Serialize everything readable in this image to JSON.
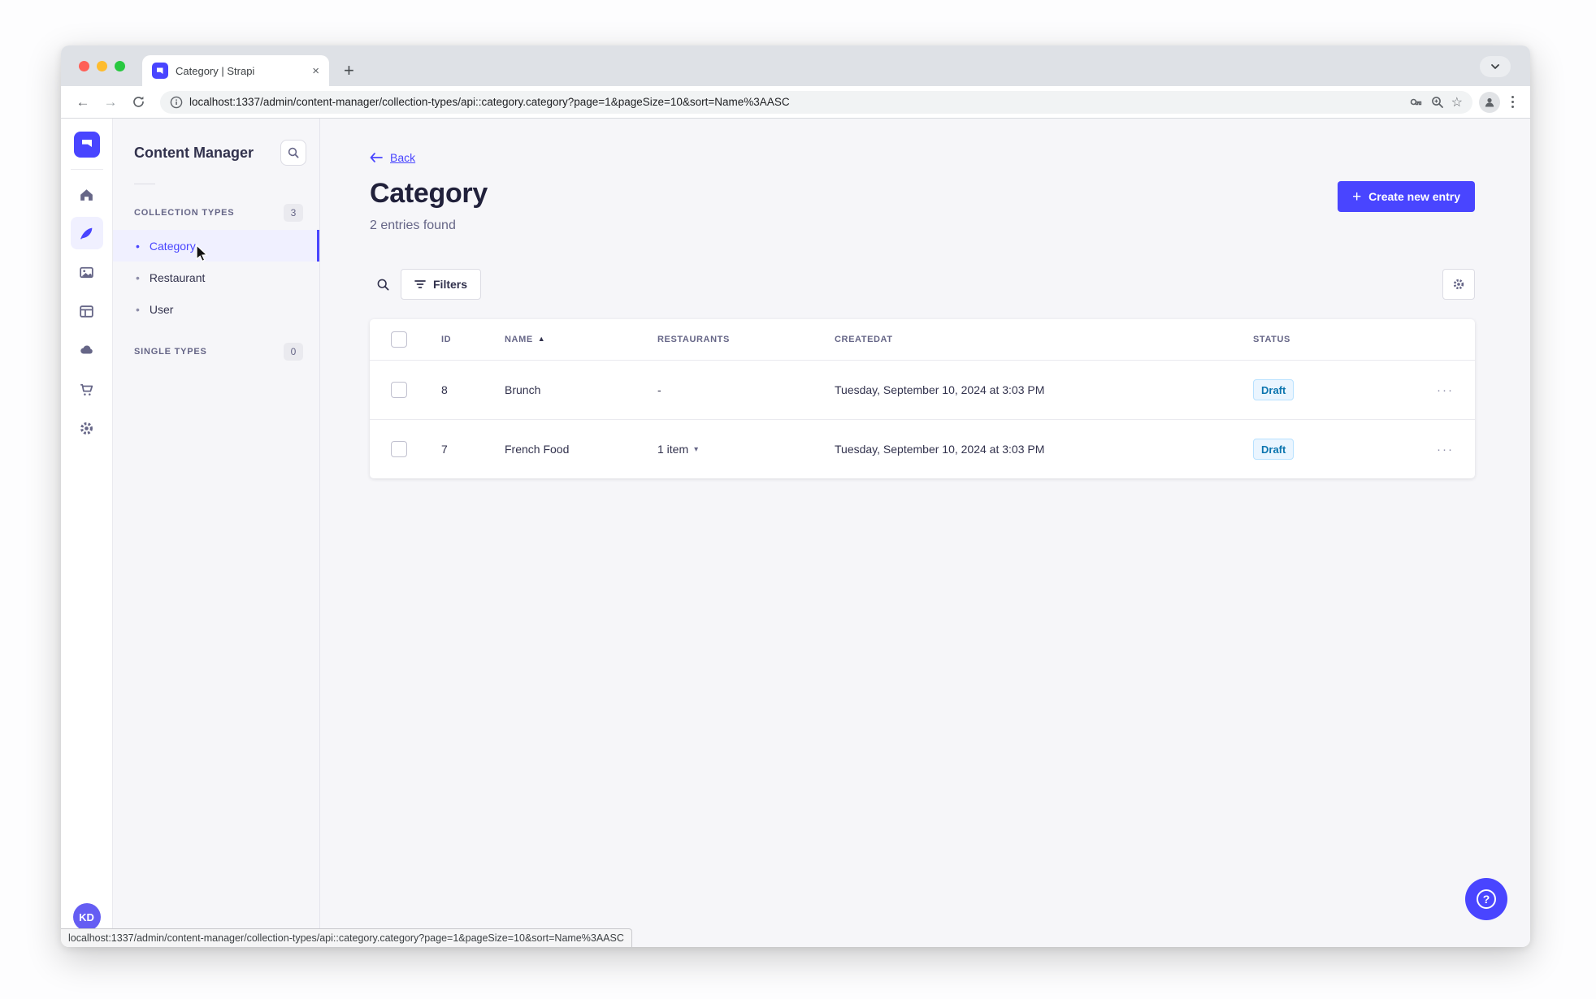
{
  "browser": {
    "tab_title": "Category | Strapi",
    "url": "localhost:1337/admin/content-manager/collection-types/api::category.category?page=1&pageSize=10&sort=Name%3AASC",
    "status_url": "localhost:1337/admin/content-manager/collection-types/api::category.category?page=1&pageSize=10&sort=Name%3AASC"
  },
  "glyphs": {
    "close": "×",
    "new_tab": "+",
    "back_arrow": "←",
    "forward_arrow": "→",
    "star": "☆",
    "bullet": "•",
    "sort_asc": "▲",
    "caret_down": "▾",
    "row_actions": "···",
    "plus": "+",
    "question": "?"
  },
  "sidebar": {
    "user_initials": "KD"
  },
  "subnav": {
    "title": "Content Manager",
    "collection_section": {
      "label": "COLLECTION TYPES",
      "count": "3",
      "items": [
        {
          "label": "Category",
          "active": true
        },
        {
          "label": "Restaurant",
          "active": false
        },
        {
          "label": "User",
          "active": false
        }
      ]
    },
    "single_section": {
      "label": "SINGLE TYPES",
      "count": "0"
    }
  },
  "page": {
    "back": "Back",
    "title": "Category",
    "subtitle": "2 entries found",
    "create_button": "Create new entry",
    "filters_button": "Filters"
  },
  "table": {
    "headers": {
      "id": "ID",
      "name": "NAME",
      "restaurants": "RESTAURANTS",
      "created": "CREATEDAT",
      "status": "STATUS"
    },
    "rows": [
      {
        "id": "8",
        "name": "Brunch",
        "restaurants": "-",
        "created": "Tuesday, September 10, 2024 at 3:03 PM",
        "status": "Draft"
      },
      {
        "id": "7",
        "name": "French Food",
        "restaurants": "1 item",
        "created": "Tuesday, September 10, 2024 at 3:03 PM",
        "status": "Draft"
      }
    ]
  },
  "colors": {
    "primary": "#4945ff",
    "active_bg": "#f0f0ff",
    "draft_bg": "#eaf5ff",
    "draft_border": "#b8e1ff",
    "draft_text": "#0c75af",
    "app_bg": "#f6f6f9",
    "tabstrip_bg": "#dee1e6"
  }
}
